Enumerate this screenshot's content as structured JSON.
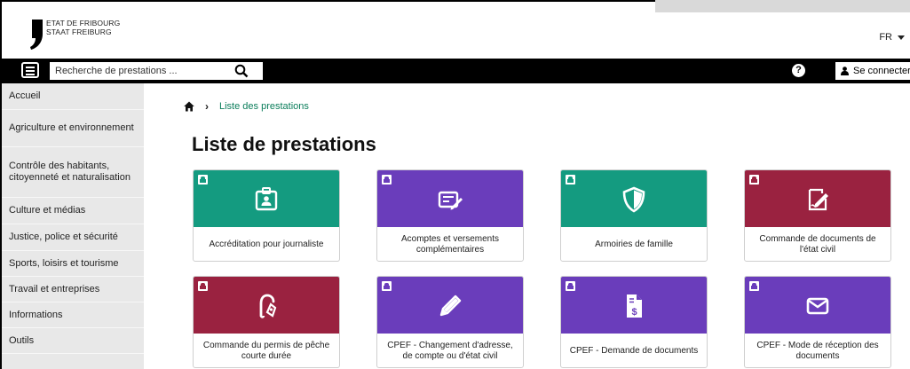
{
  "header": {
    "logo_line1": "ETAT DE FRIBOURG",
    "logo_line2": "STAAT FREIBURG",
    "language": "FR"
  },
  "topbar": {
    "search_placeholder": "Recherche de prestations ...",
    "help_label": "?",
    "login_label": "Se connecter"
  },
  "sidebar": {
    "items": [
      {
        "label": "Accueil"
      },
      {
        "label": "Agriculture et environnement"
      },
      {
        "label": "Contrôle des habitants, citoyenneté et naturalisation"
      },
      {
        "label": "Culture et médias"
      },
      {
        "label": "Justice, police et sécurité"
      },
      {
        "label": "Sports, loisirs et tourisme"
      },
      {
        "label": "Travail et entreprises"
      },
      {
        "label": "Informations"
      },
      {
        "label": "Outils"
      }
    ]
  },
  "breadcrumb": {
    "current": "Liste des prestations"
  },
  "page_title": "Liste de prestations",
  "colors": {
    "green": "#149b80",
    "purple": "#6a3dbb",
    "maroon": "#9a2240",
    "link": "#0a7d5a"
  },
  "cards": [
    {
      "label": "Accréditation pour journaliste",
      "color": "#149b80",
      "icon": "id-badge-icon"
    },
    {
      "label": "Acomptes et versements complémentaires",
      "color": "#6a3dbb",
      "icon": "edit-document-icon"
    },
    {
      "label": "Armoiries de famille",
      "color": "#149b80",
      "icon": "shield-icon"
    },
    {
      "label": "Commande de documents de l'état civil",
      "color": "#9a2240",
      "icon": "signature-icon"
    },
    {
      "label": "Commande du permis de pêche courte durée",
      "color": "#9a2240",
      "icon": "fishing-hook-icon"
    },
    {
      "label": "CPEF - Changement d'adresse, de compte ou d'état civil",
      "color": "#6a3dbb",
      "icon": "pencil-icon"
    },
    {
      "label": "CPEF - Demande de documents",
      "color": "#6a3dbb",
      "icon": "invoice-dollar-icon"
    },
    {
      "label": "CPEF - Mode de réception des documents",
      "color": "#6a3dbb",
      "icon": "envelope-icon"
    }
  ]
}
